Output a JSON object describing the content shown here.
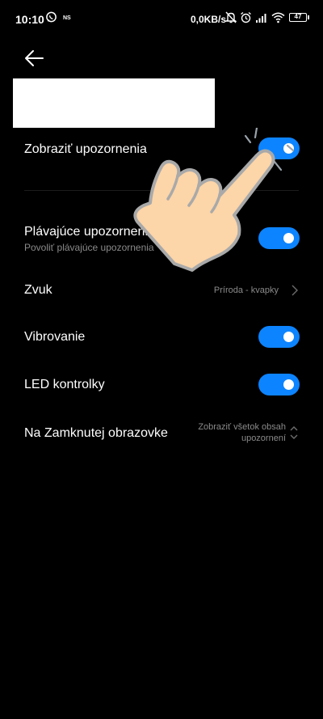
{
  "status_bar": {
    "time": "10:10",
    "ns_label": "NS",
    "net_speed": "0,0KB/s",
    "battery": "47"
  },
  "header": {
    "back_icon": "back-arrow-icon"
  },
  "settings": {
    "show_notifications": {
      "label": "Zobraziť upozornenia",
      "on": true
    },
    "floating": {
      "label": "Plávajúce upozornenia",
      "sublabel": "Povoliť plávajúce upozornenia",
      "on": true
    },
    "sound": {
      "label": "Zvuk",
      "value": "Príroda - kvapky"
    },
    "vibration": {
      "label": "Vibrovanie",
      "on": true
    },
    "led": {
      "label": "LED kontrolky",
      "on": true
    },
    "lockscreen": {
      "label": "Na Zamknutej obrazovke",
      "value_line1": "Zobraziť všetok obsah",
      "value_line2": "upozornení"
    }
  },
  "colors": {
    "accent": "#0d84ff",
    "background": "#000000",
    "secondary_text": "#8a8a8a"
  }
}
